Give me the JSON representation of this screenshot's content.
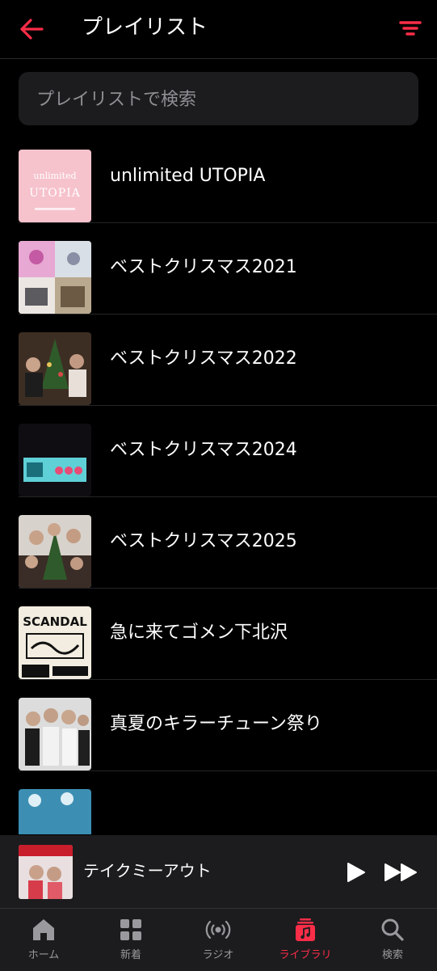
{
  "accent_color": "#fa2d48",
  "header": {
    "title": "プレイリスト",
    "back_icon": "arrow-left-icon",
    "sort_icon": "sort-lines-icon"
  },
  "search": {
    "placeholder": "プレイリストで検索",
    "value": ""
  },
  "playlists": [
    {
      "label": ""
    },
    {
      "label": "unlimited UTOPIA",
      "artwork_text": "unlimited UTOPIA"
    },
    {
      "label": "ベストクリスマス2021"
    },
    {
      "label": "ベストクリスマス2022"
    },
    {
      "label": "ベストクリスマス2024"
    },
    {
      "label": "ベストクリスマス2025"
    },
    {
      "label": "急に来てゴメン下北沢",
      "artwork_text": "SCANDAL"
    },
    {
      "label": "真夏のキラーチューン祭り"
    },
    {
      "label": ""
    }
  ],
  "now_playing": {
    "title": "テイクミーアウト",
    "play_icon": "play-icon",
    "next_icon": "fast-forward-icon"
  },
  "tabs": [
    {
      "label": "ホーム",
      "icon": "home-icon",
      "active": false
    },
    {
      "label": "新着",
      "icon": "grid-icon",
      "active": false
    },
    {
      "label": "ラジオ",
      "icon": "radio-waves-icon",
      "active": false
    },
    {
      "label": "ライブラリ",
      "icon": "music-library-icon",
      "active": true
    },
    {
      "label": "検索",
      "icon": "search-icon",
      "active": false
    }
  ]
}
